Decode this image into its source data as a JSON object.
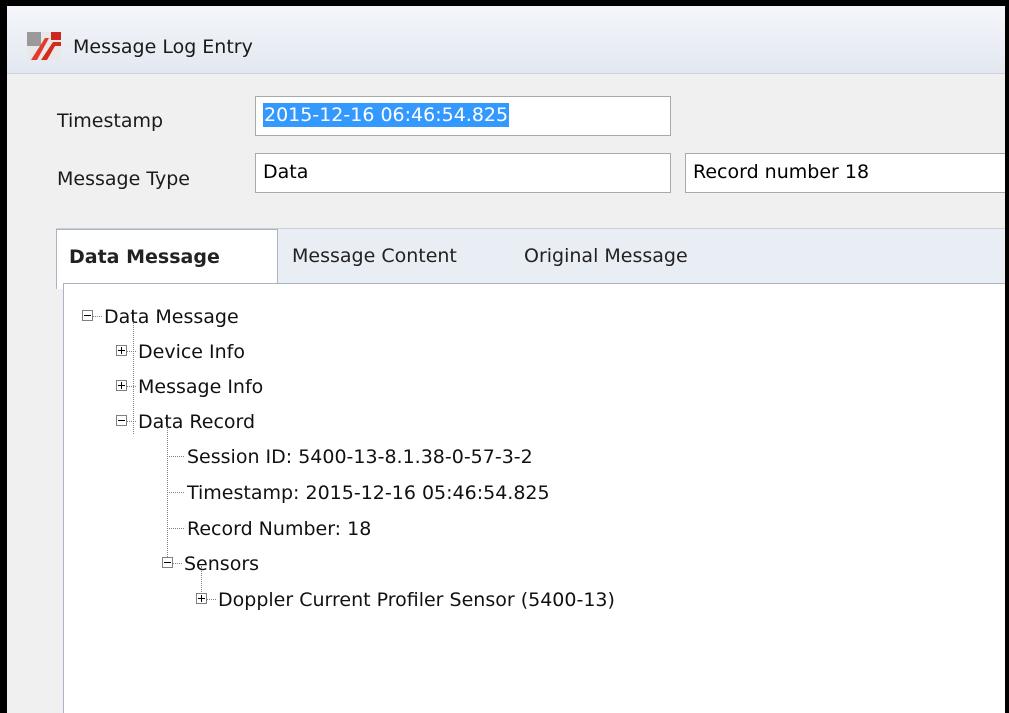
{
  "window": {
    "title": "Message Log Entry",
    "icon": "app-logo-icon"
  },
  "form": {
    "timestamp_label": "Timestamp",
    "timestamp_value": "2015-12-16 06:46:54.825",
    "message_type_label": "Message Type",
    "message_type_value": "Data",
    "record_value": "Record number 18"
  },
  "tabs": [
    {
      "label": "Data Message",
      "selected": true
    },
    {
      "label": "Message Content",
      "selected": false
    },
    {
      "label": "Original Message",
      "selected": false
    }
  ],
  "tree": {
    "root": "Data Message",
    "device_info": "Device Info",
    "message_info": "Message Info",
    "data_record": "Data Record",
    "session_id": "Session ID: 5400-13-8.1.38-0-57-3-2",
    "timestamp": "Timestamp: 2015-12-16 05:46:54.825",
    "record_number": "Record Number: 18",
    "sensors": "Sensors",
    "doppler_sensor": "Doppler Current Profiler Sensor (5400-13)"
  },
  "colors": {
    "selection": "#3399ff",
    "window_border": "#000000",
    "tab_strip": "#e9edf4"
  }
}
